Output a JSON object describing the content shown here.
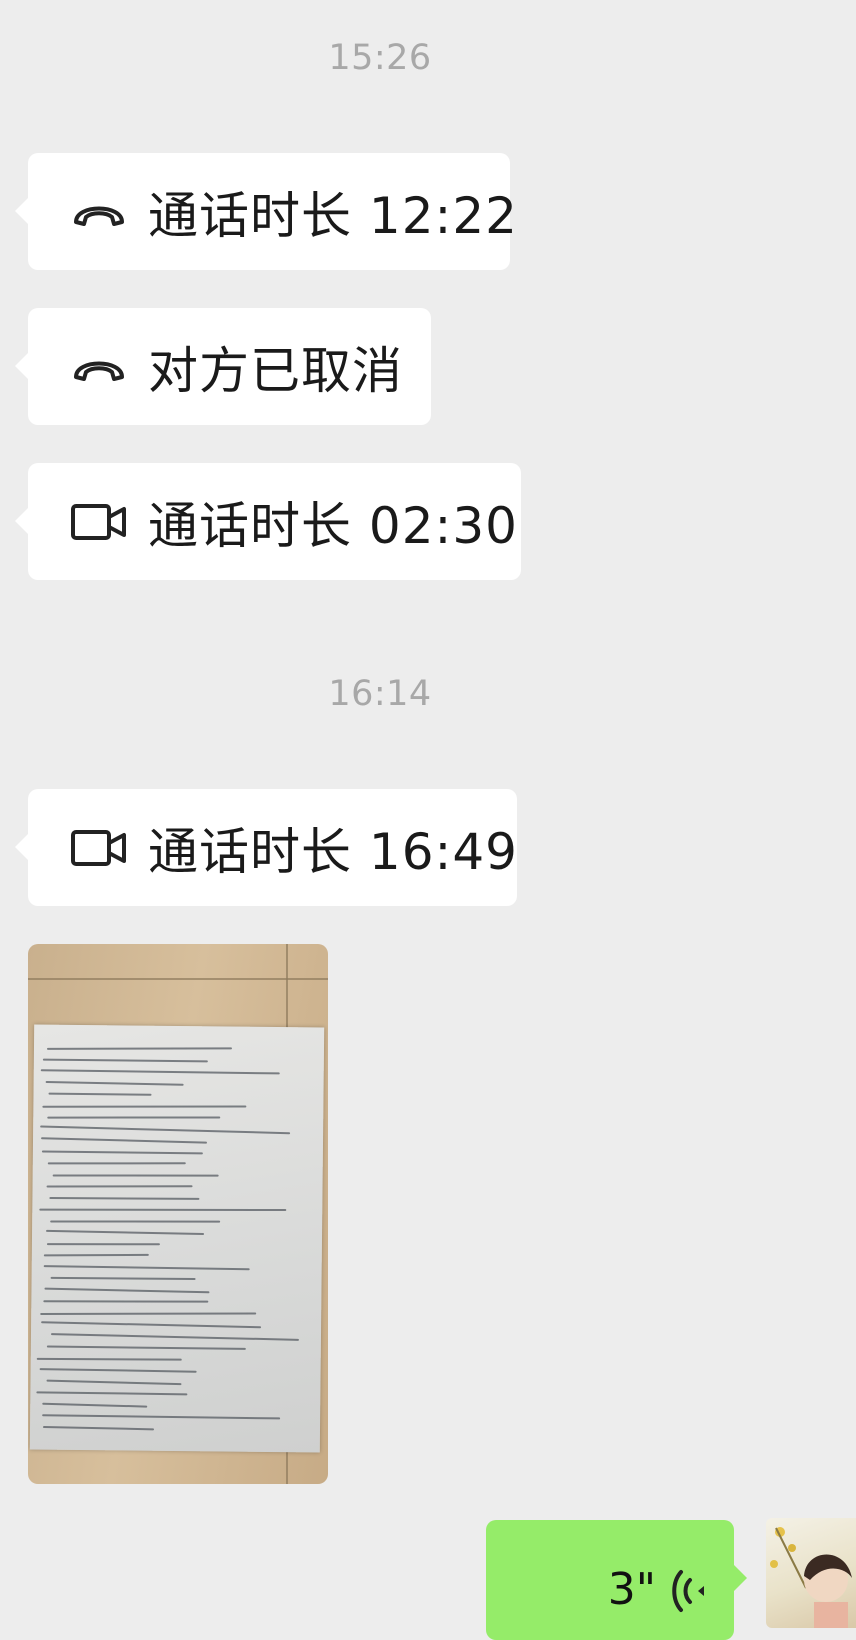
{
  "messages": {
    "timestamp_1": "15:26",
    "call_1": {
      "icon": "phone-icon",
      "text": "通话时长 12:22"
    },
    "call_2": {
      "icon": "phone-icon",
      "text": "对方已取消"
    },
    "call_3": {
      "icon": "video-icon",
      "text": "通话时长 02:30"
    },
    "timestamp_2": "16:14",
    "call_4": {
      "icon": "video-icon",
      "text": "通话时长 16:49"
    },
    "image_message": {
      "description_icon": "handwritten-note-photo"
    },
    "voice_message": {
      "duration": "3\"",
      "icon": "voice-wave-icon"
    }
  },
  "colors": {
    "background": "#ededed",
    "incoming_bubble": "#ffffff",
    "outgoing_bubble": "#95ec69",
    "timestamp": "#a8a8a8",
    "text": "#1a1a1a"
  }
}
